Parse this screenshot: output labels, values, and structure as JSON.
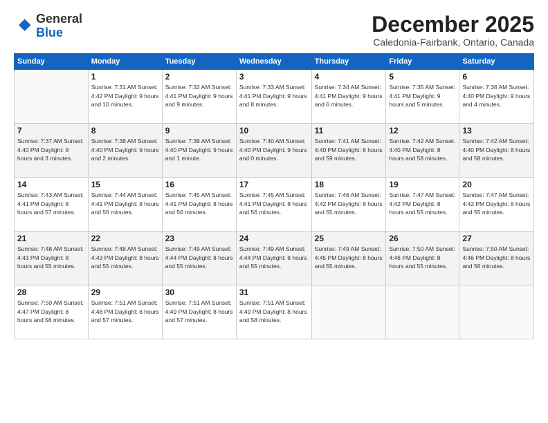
{
  "header": {
    "logo_general": "General",
    "logo_blue": "Blue",
    "month_title": "December 2025",
    "location": "Caledonia-Fairbank, Ontario, Canada"
  },
  "columns": [
    "Sunday",
    "Monday",
    "Tuesday",
    "Wednesday",
    "Thursday",
    "Friday",
    "Saturday"
  ],
  "weeks": [
    [
      {
        "day": "",
        "info": ""
      },
      {
        "day": "1",
        "info": "Sunrise: 7:31 AM\nSunset: 4:42 PM\nDaylight: 9 hours\nand 10 minutes."
      },
      {
        "day": "2",
        "info": "Sunrise: 7:32 AM\nSunset: 4:41 PM\nDaylight: 9 hours\nand 9 minutes."
      },
      {
        "day": "3",
        "info": "Sunrise: 7:33 AM\nSunset: 4:41 PM\nDaylight: 9 hours\nand 8 minutes."
      },
      {
        "day": "4",
        "info": "Sunrise: 7:34 AM\nSunset: 4:41 PM\nDaylight: 9 hours\nand 6 minutes."
      },
      {
        "day": "5",
        "info": "Sunrise: 7:35 AM\nSunset: 4:41 PM\nDaylight: 9 hours\nand 5 minutes."
      },
      {
        "day": "6",
        "info": "Sunrise: 7:36 AM\nSunset: 4:40 PM\nDaylight: 9 hours\nand 4 minutes."
      }
    ],
    [
      {
        "day": "7",
        "info": "Sunrise: 7:37 AM\nSunset: 4:40 PM\nDaylight: 9 hours\nand 3 minutes."
      },
      {
        "day": "8",
        "info": "Sunrise: 7:38 AM\nSunset: 4:40 PM\nDaylight: 9 hours\nand 2 minutes."
      },
      {
        "day": "9",
        "info": "Sunrise: 7:39 AM\nSunset: 4:40 PM\nDaylight: 9 hours\nand 1 minute."
      },
      {
        "day": "10",
        "info": "Sunrise: 7:40 AM\nSunset: 4:40 PM\nDaylight: 9 hours\nand 0 minutes."
      },
      {
        "day": "11",
        "info": "Sunrise: 7:41 AM\nSunset: 4:40 PM\nDaylight: 8 hours\nand 59 minutes."
      },
      {
        "day": "12",
        "info": "Sunrise: 7:42 AM\nSunset: 4:40 PM\nDaylight: 8 hours\nand 58 minutes."
      },
      {
        "day": "13",
        "info": "Sunrise: 7:42 AM\nSunset: 4:40 PM\nDaylight: 8 hours\nand 58 minutes."
      }
    ],
    [
      {
        "day": "14",
        "info": "Sunrise: 7:43 AM\nSunset: 4:41 PM\nDaylight: 8 hours\nand 57 minutes."
      },
      {
        "day": "15",
        "info": "Sunrise: 7:44 AM\nSunset: 4:41 PM\nDaylight: 8 hours\nand 56 minutes."
      },
      {
        "day": "16",
        "info": "Sunrise: 7:45 AM\nSunset: 4:41 PM\nDaylight: 8 hours\nand 56 minutes."
      },
      {
        "day": "17",
        "info": "Sunrise: 7:45 AM\nSunset: 4:41 PM\nDaylight: 8 hours\nand 56 minutes."
      },
      {
        "day": "18",
        "info": "Sunrise: 7:46 AM\nSunset: 4:42 PM\nDaylight: 8 hours\nand 55 minutes."
      },
      {
        "day": "19",
        "info": "Sunrise: 7:47 AM\nSunset: 4:42 PM\nDaylight: 8 hours\nand 55 minutes."
      },
      {
        "day": "20",
        "info": "Sunrise: 7:47 AM\nSunset: 4:42 PM\nDaylight: 8 hours\nand 55 minutes."
      }
    ],
    [
      {
        "day": "21",
        "info": "Sunrise: 7:48 AM\nSunset: 4:43 PM\nDaylight: 8 hours\nand 55 minutes."
      },
      {
        "day": "22",
        "info": "Sunrise: 7:48 AM\nSunset: 4:43 PM\nDaylight: 8 hours\nand 55 minutes."
      },
      {
        "day": "23",
        "info": "Sunrise: 7:49 AM\nSunset: 4:44 PM\nDaylight: 8 hours\nand 55 minutes."
      },
      {
        "day": "24",
        "info": "Sunrise: 7:49 AM\nSunset: 4:44 PM\nDaylight: 8 hours\nand 55 minutes."
      },
      {
        "day": "25",
        "info": "Sunrise: 7:49 AM\nSunset: 4:45 PM\nDaylight: 8 hours\nand 55 minutes."
      },
      {
        "day": "26",
        "info": "Sunrise: 7:50 AM\nSunset: 4:46 PM\nDaylight: 8 hours\nand 55 minutes."
      },
      {
        "day": "27",
        "info": "Sunrise: 7:50 AM\nSunset: 4:46 PM\nDaylight: 8 hours\nand 56 minutes."
      }
    ],
    [
      {
        "day": "28",
        "info": "Sunrise: 7:50 AM\nSunset: 4:47 PM\nDaylight: 8 hours\nand 56 minutes."
      },
      {
        "day": "29",
        "info": "Sunrise: 7:51 AM\nSunset: 4:48 PM\nDaylight: 8 hours\nand 57 minutes."
      },
      {
        "day": "30",
        "info": "Sunrise: 7:51 AM\nSunset: 4:49 PM\nDaylight: 8 hours\nand 57 minutes."
      },
      {
        "day": "31",
        "info": "Sunrise: 7:51 AM\nSunset: 4:49 PM\nDaylight: 8 hours\nand 58 minutes."
      },
      {
        "day": "",
        "info": ""
      },
      {
        "day": "",
        "info": ""
      },
      {
        "day": "",
        "info": ""
      }
    ]
  ]
}
